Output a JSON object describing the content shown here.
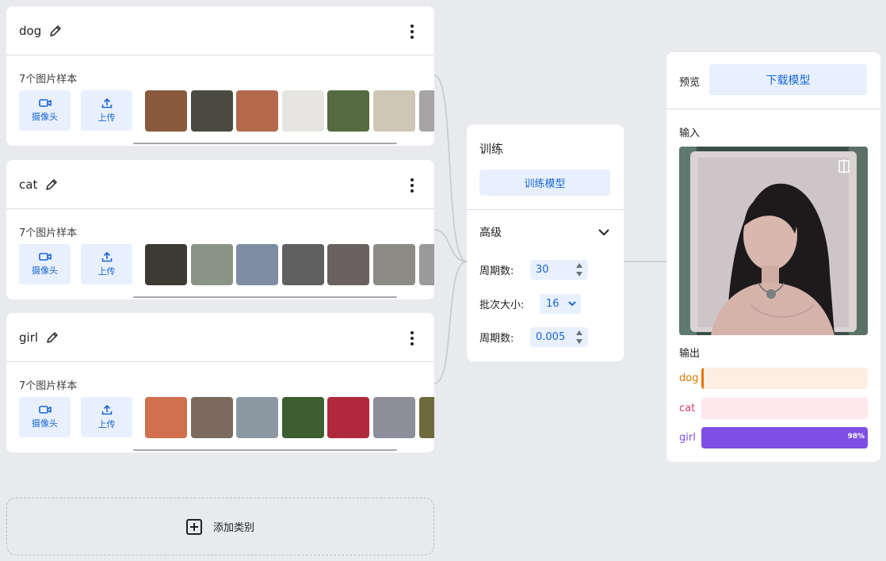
{
  "classes": [
    {
      "name": "dog",
      "sample_count": "7个图片样本",
      "camera_label": "摄像头",
      "upload_label": "上传",
      "thumb_colors": [
        "#8a5a3c",
        "#4a4a3e",
        "#b5694b",
        "#e7e5e2",
        "#556b3f",
        "#cfc6b5",
        "#a7a4a6"
      ]
    },
    {
      "name": "cat",
      "sample_count": "7个图片样本",
      "camera_label": "摄像头",
      "upload_label": "上传",
      "thumb_colors": [
        "#3d3a33",
        "#8a9484",
        "#7e8ca4",
        "#5f5f5f",
        "#6b6060",
        "#8d8b85",
        "#9a9a9a"
      ]
    },
    {
      "name": "girl",
      "sample_count": "7个图片样本",
      "camera_label": "摄像头",
      "upload_label": "上传",
      "thumb_colors": [
        "#d0704e",
        "#7c6a5e",
        "#8b98a2",
        "#3c5e30",
        "#b0283c",
        "#8c8e9a",
        "#6e6a3c"
      ]
    }
  ],
  "add_class_label": "添加类别",
  "training": {
    "title": "训练",
    "train_button": "训练模型",
    "advanced_label": "高级",
    "epochs_label": "周期数:",
    "epochs_value": "30",
    "batch_label": "批次大小:",
    "batch_value": "16",
    "rate_label": "周期数:",
    "rate_value": "0.005"
  },
  "preview": {
    "title": "预览",
    "download_button": "下载模型",
    "input_label": "输入",
    "output_label": "输出",
    "outputs": [
      {
        "label": "dog",
        "value": 0.01,
        "label_color": "#e37400",
        "bar_bg": "#fdeee3",
        "fill_color": "#e37400",
        "pct": ""
      },
      {
        "label": "cat",
        "value": 0.0,
        "label_color": "#d33b68",
        "bar_bg": "#fde8ec",
        "fill_color": "#d33b68",
        "pct": ""
      },
      {
        "label": "girl",
        "value": 1.0,
        "label_color": "#7e4ee6",
        "bar_bg": "#efe6fd",
        "fill_color": "#7e4ee6",
        "pct": "98%"
      }
    ]
  }
}
